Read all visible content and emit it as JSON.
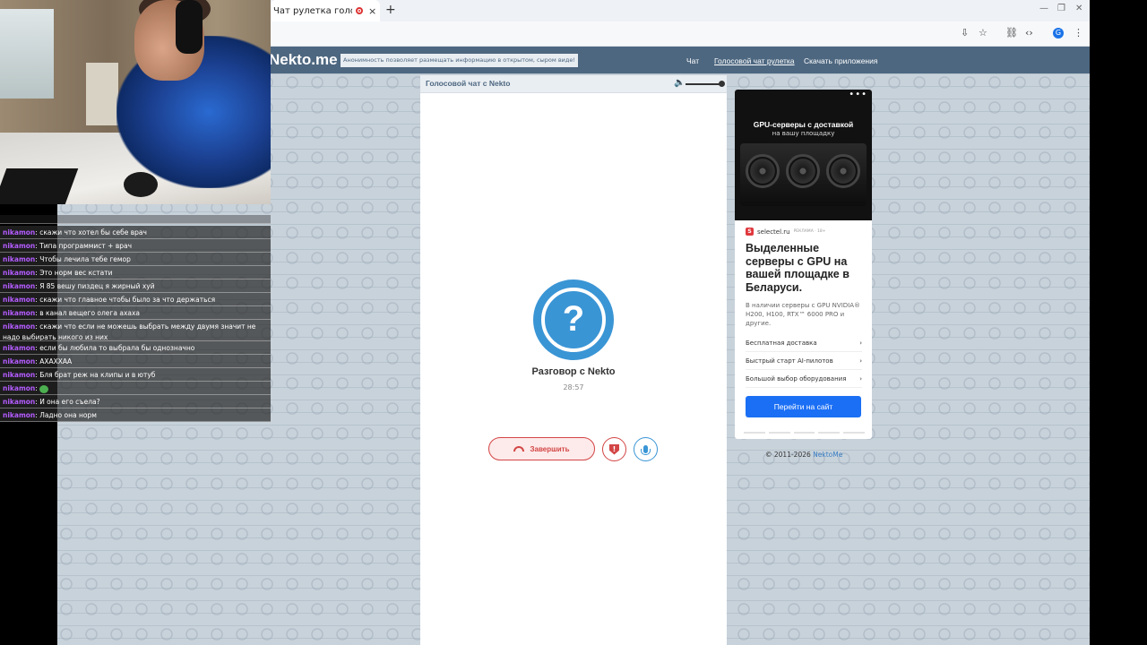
{
  "browser": {
    "tab_title": "Чат рулетка голосов",
    "tab_close": "×",
    "new_tab": "+",
    "profile_initial": "G"
  },
  "site": {
    "logo": "Nekto.me",
    "notice": "Анонимность позволяет размещать информацию в открытом, сыром виде!",
    "nav": [
      "Чат",
      "Голосовой чат рулетка",
      "Скачать приложения"
    ]
  },
  "chat_panel": {
    "title": "Голосовой чат с Nekto",
    "avatar_symbol": "?",
    "conversation_title": "Разговор с Nekto",
    "timer": "28:57",
    "end_button": "Завершить",
    "report_symbol": "!",
    "volume_level": 1.0
  },
  "ad": {
    "menu": "•••",
    "headline": "GPU-серверы с доставкой",
    "subheadline": "на вашу площадку",
    "brand": "selectel.ru",
    "brand_note": "РЕКЛАМА · 18+",
    "brand_mark": "S",
    "title": "Выделенные серверы с GPU на вашей площадке в Беларуси.",
    "description": "В наличии серверы с GPU NVIDIA® H200, H100, RTX™ 6000 PRO и другие.",
    "items": [
      "Бесплатная доставка",
      "Быстрый старт AI-пилотов",
      "Большой выбор оборудования"
    ],
    "button": "Перейти на сайт"
  },
  "footer": {
    "copyright": "© 2011-2026",
    "link": "NektoMe"
  },
  "stream_chat": {
    "rows": [
      {
        "nick": "",
        "text": ""
      },
      {
        "nick": "nikamon",
        "text": ": скажи что хотел бы себе врач"
      },
      {
        "nick": "nikamon",
        "text": ": Типа программист + врач"
      },
      {
        "nick": "nikamon",
        "text": ": Чтобы лечила тебе гемор"
      },
      {
        "nick": "nikamon",
        "text": ": Это норм вес кстати"
      },
      {
        "nick": "nikamon",
        "text": ": Я 85 вешу пиздец я жирный хуй"
      },
      {
        "nick": "nikamon",
        "text": ": скажи что главное чтобы было за что держаться"
      },
      {
        "nick": "nikamon",
        "text": ": в канал вещего олега ахаха"
      },
      {
        "nick": "nikamon",
        "text": ": скажи что если не можешь выбрать между двумя значит не надо выбирать никого из них"
      },
      {
        "nick": "nikamon",
        "text": ": если бы любила то выбрала бы однозначно"
      },
      {
        "nick": "nikamon",
        "text": ": АХАХХАА"
      },
      {
        "nick": "nikamon",
        "text": ": Бля брат реж на клипы и в ютуб"
      },
      {
        "nick": "nikamon",
        "text": ": "
      },
      {
        "nick": "nikamon",
        "text": ": И она его съела?"
      },
      {
        "nick": "nikamon",
        "text": ": Ладно она норм"
      }
    ]
  }
}
